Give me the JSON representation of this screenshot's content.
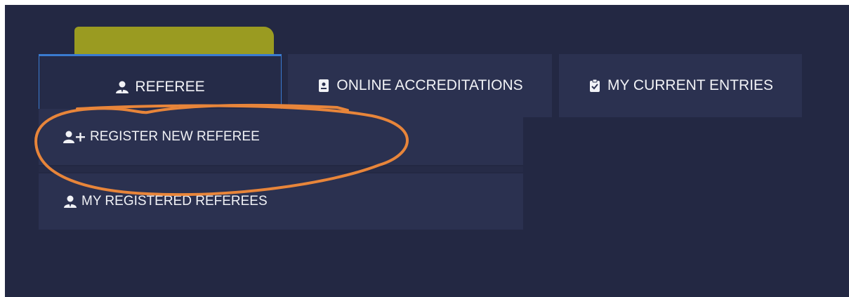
{
  "tabs": {
    "referee": {
      "label": "REFEREE",
      "icon": "user-icon"
    },
    "accreditations": {
      "label": "ONLINE ACCREDITATIONS",
      "icon": "id-card-icon"
    },
    "entries": {
      "label": "MY CURRENT ENTRIES",
      "icon": "clipboard-check-icon"
    }
  },
  "dropdown": {
    "register": {
      "label": "REGISTER NEW REFEREE",
      "icon": "user-plus-icon"
    },
    "registered": {
      "label": "MY REGISTERED REFEREES",
      "icon": "user-icon"
    }
  },
  "colors": {
    "background": "#232843",
    "tab": "#2b3150",
    "active_border": "#3a7bd0",
    "highlight": "#9a9b21",
    "annotation": "#e8853a"
  }
}
